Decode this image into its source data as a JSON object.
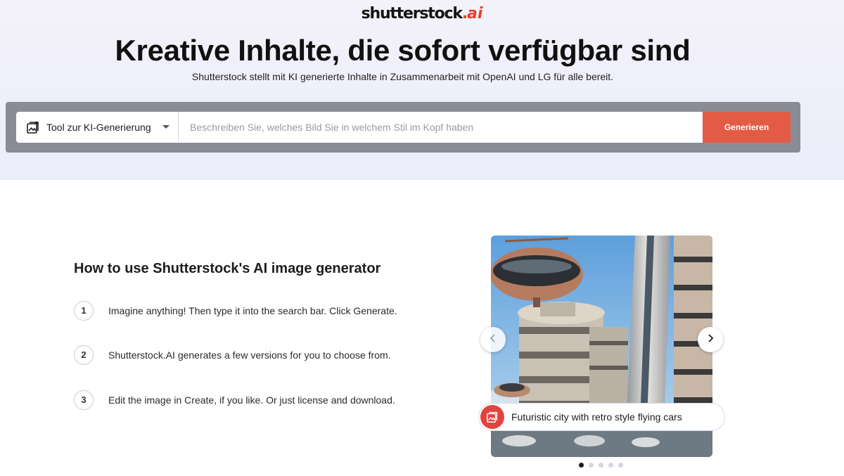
{
  "brand": {
    "logo_text": "shutterstock",
    "logo_suffix_dot": ".",
    "logo_suffix_ai": "ai",
    "accent_color": "#e35b45"
  },
  "hero": {
    "headline": "Kreative Inhalte, die sofort verfügbar sind",
    "subline": "Shutterstock stellt mit KI generierte Inhalte in Zusammenarbeit mit OpenAI und LG für alle bereit."
  },
  "search": {
    "tool_label": "Tool zur KI-Generierung",
    "tool_icon": "ai-image-generator-icon",
    "placeholder": "Beschreiben Sie, welches Bild Sie in welchem Stil im Kopf haben",
    "value": "",
    "button_label": "Generieren"
  },
  "howto": {
    "title": "How to use Shutterstock's AI image generator",
    "steps": [
      {
        "num": "1",
        "text": "Imagine anything! Then type it into the search bar. Click Generate."
      },
      {
        "num": "2",
        "text": "Shutterstock.AI generates a few versions for you to choose from."
      },
      {
        "num": "3",
        "text": "Edit the image in Create, if you like. Or just license and download."
      }
    ]
  },
  "carousel": {
    "caption": "Futuristic city with retro style flying cars",
    "slide_count": 5,
    "active_slide": 1,
    "prev_icon": "chevron-left-icon",
    "next_icon": "chevron-right-icon"
  }
}
